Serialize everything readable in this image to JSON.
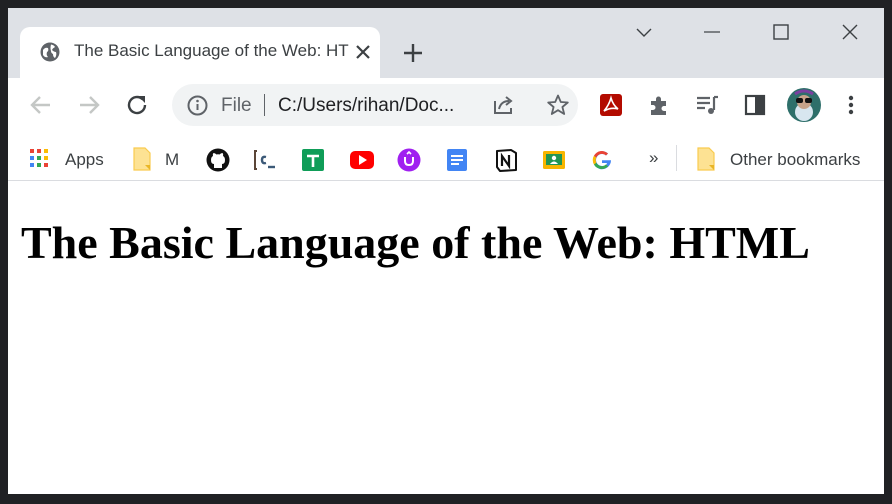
{
  "browser": {
    "tab": {
      "title": "The Basic Language of the Web: HTML"
    },
    "omnibox": {
      "scheme_label": "File",
      "url": "C:/Users/rihan/Doc..."
    },
    "bookmarks": {
      "apps_label": "Apps",
      "m_folder_label": "M",
      "overflow_label": "»",
      "other_label": "Other bookmarks"
    },
    "icons": [
      "globe-icon",
      "close-icon",
      "plus-icon",
      "chevron-down-icon",
      "minimize-icon",
      "maximize-icon",
      "close-window-icon",
      "back-arrow-icon",
      "forward-arrow-icon",
      "reload-icon",
      "info-icon",
      "share-icon",
      "star-icon",
      "pdf-extension-icon",
      "puzzle-extension-icon",
      "media-queue-icon",
      "side-panel-icon",
      "profile-avatar",
      "kebab-menu-icon",
      "apps-grid-icon",
      "folder-icon",
      "github-icon",
      "codechef-icon",
      "google-sheets-icon",
      "youtube-icon",
      "upwork-icon",
      "google-docs-icon",
      "notion-icon",
      "google-classroom-icon",
      "google-icon"
    ]
  },
  "page": {
    "heading": "The Basic Language of the Web: HTML"
  }
}
